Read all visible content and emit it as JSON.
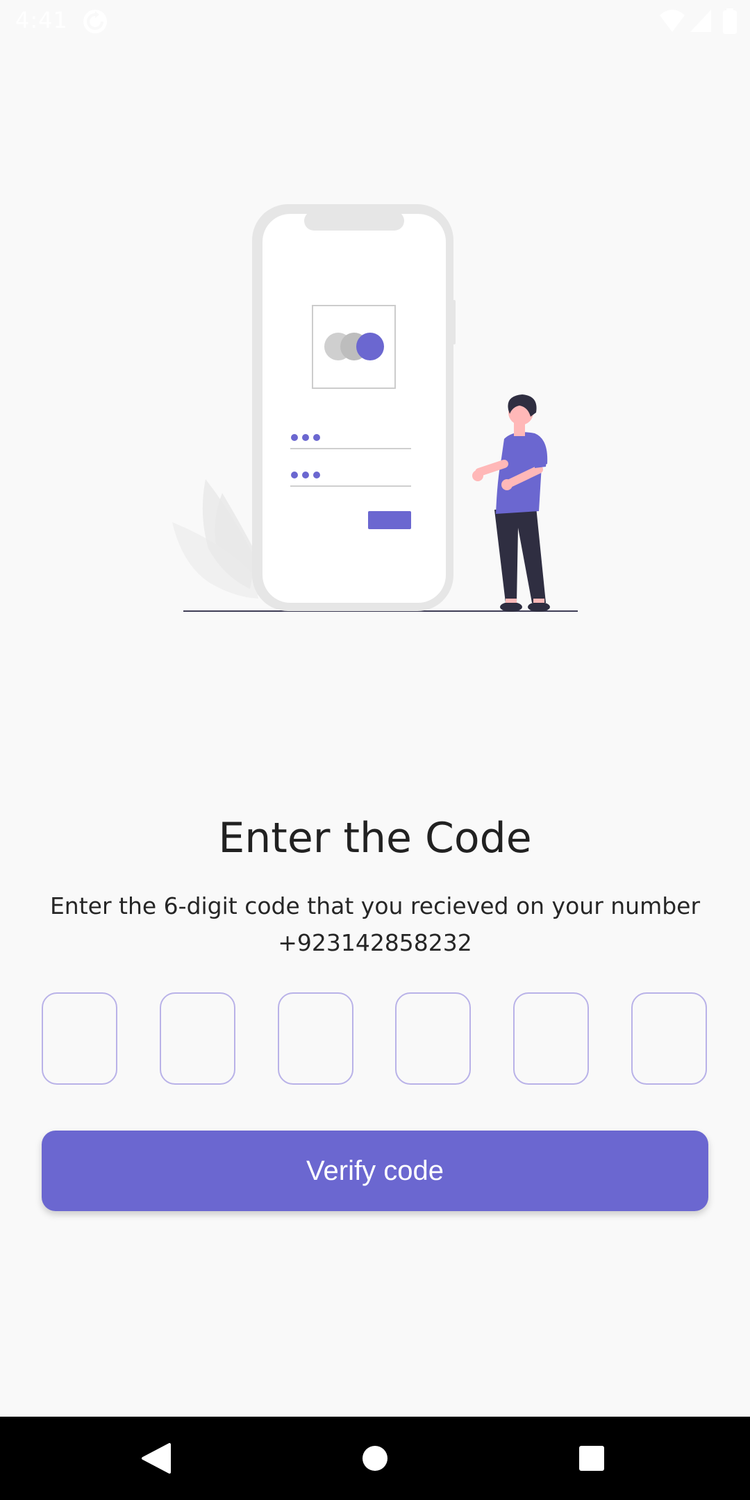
{
  "status_bar": {
    "time": "4:41",
    "icons": [
      "sync-icon",
      "wifi-icon",
      "signal-icon",
      "battery-icon"
    ]
  },
  "illustration": {
    "name": "login-phone-illustration"
  },
  "content": {
    "title": "Enter the Code",
    "subtitle": "Enter the 6-digit code that you recieved on your number +923142858232",
    "otp_boxes": [
      "",
      "",
      "",
      "",
      "",
      ""
    ],
    "verify_label": "Verify code"
  },
  "nav_bar": {
    "buttons": [
      "back-icon",
      "home-icon",
      "recents-icon"
    ]
  },
  "colors": {
    "accent": "#6b67d0",
    "background": "#f9f9f9",
    "otp_border": "#b9b2e8",
    "nav_background": "#000000"
  }
}
